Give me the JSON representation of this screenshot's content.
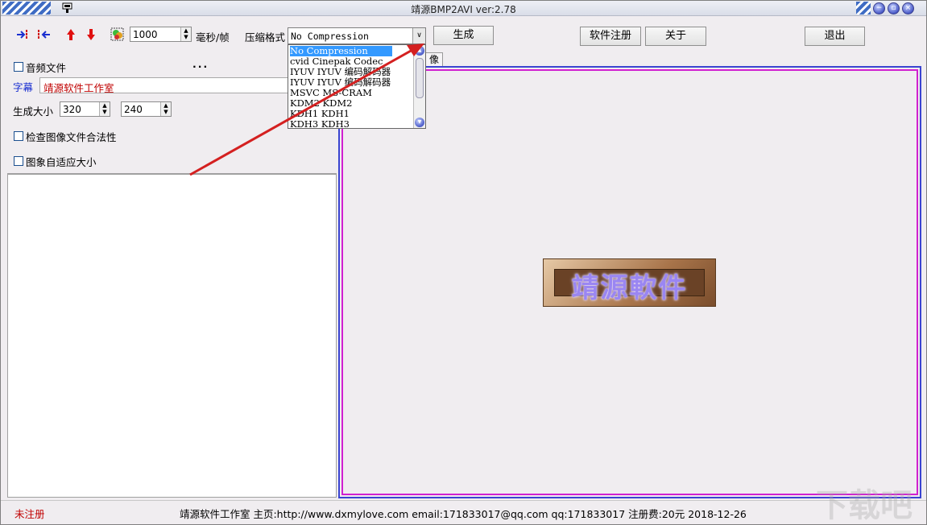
{
  "window": {
    "title": "靖源BMP2AVI ver:2.78"
  },
  "toolbar": {
    "interval_value": "1000",
    "interval_unit": "毫秒/帧",
    "compress_label": "压缩格式",
    "compress_value": "No Compression",
    "generate_label": "生成",
    "register_label": "软件注册",
    "about_label": "关于",
    "exit_label": "退出"
  },
  "dropdown": {
    "items": [
      "No Compression",
      "cvid Cinepak Codec",
      "IYUV IYUV 编码解码器",
      "IYUV IYUV 编码解码器",
      "MSVC MS-CRAM",
      "KDM2 KDM2",
      "KDH1 KDH1",
      "KDH3 KDH3"
    ]
  },
  "left": {
    "audio_label": "音频文件",
    "audio_browse": "...",
    "subtitle_label": "字幕",
    "subtitle_value": "靖源软件工作室",
    "size_label": "生成大小",
    "width_value": "320",
    "height_value": "240",
    "check_validity_label": "检查图像文件合法性",
    "auto_fit_label": "图象自适应大小"
  },
  "preview": {
    "tab_label": "像",
    "logo_text": "靖源軟件"
  },
  "status": {
    "registration": "未注册",
    "info": "靖源软件工作室  主页:http://www.dxmylove.com email:171833017@qq.com qq:171833017  注册费:20元 2018-12-26"
  },
  "watermark": "下载吧",
  "colors": {
    "accent": "#3a44d0",
    "preview_border": "#d020d0",
    "annotation_arrow": "#d42020",
    "unregistered": "#c00000"
  }
}
